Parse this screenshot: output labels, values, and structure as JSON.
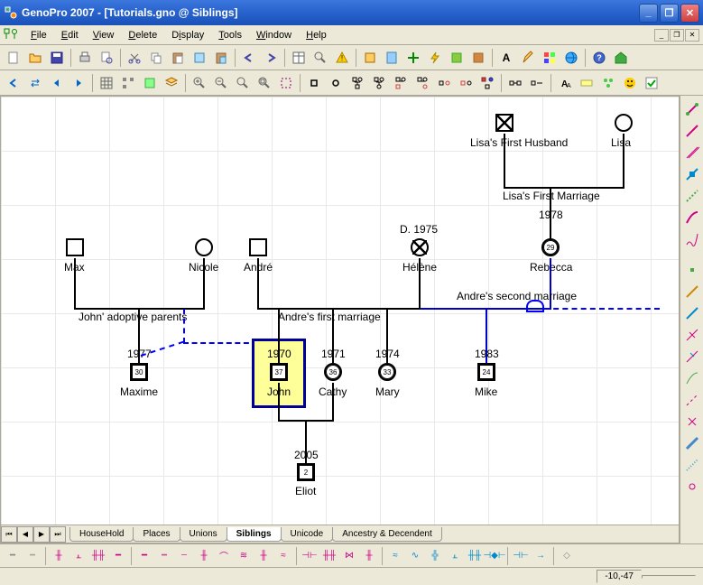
{
  "window": {
    "title": "GenoPro 2007 - [Tutorials.gno @ Siblings]"
  },
  "menus": [
    "File",
    "Edit",
    "View",
    "Delete",
    "Display",
    "Tools",
    "Window",
    "Help"
  ],
  "tabs": [
    "HouseHold",
    "Places",
    "Unions",
    "Siblings",
    "Unicode",
    "Ancestry & Decendent"
  ],
  "active_tab": 3,
  "status": {
    "coords": "-10,-47"
  },
  "people": {
    "lisas_first_husband": {
      "name": "Lisa's First Husband"
    },
    "lisa": {
      "name": "Lisa"
    },
    "max": {
      "name": "Max"
    },
    "nicole": {
      "name": "Nicole"
    },
    "andre": {
      "name": "André"
    },
    "helene": {
      "name": "Hélène",
      "death": "D. 1975"
    },
    "rebecca": {
      "name": "Rebecca",
      "age": "29",
      "year": "1978"
    },
    "maxime": {
      "name": "Maxime",
      "age": "30",
      "year": "1977"
    },
    "john": {
      "name": "John",
      "age": "37",
      "year": "1970"
    },
    "cathy": {
      "name": "Cathy",
      "age": "36",
      "year": "1971"
    },
    "mary": {
      "name": "Mary",
      "age": "33",
      "year": "1974"
    },
    "mike": {
      "name": "Mike",
      "age": "24",
      "year": "1983"
    },
    "eliot": {
      "name": "Eliot",
      "age": "2",
      "year": "2005"
    }
  },
  "marriages": {
    "lisas_first": "Lisa's First Marriage",
    "johns_adoptive": "John' adoptive parents",
    "andres_first": "Andre's first marriage",
    "andres_second": "Andre's second marriage"
  }
}
